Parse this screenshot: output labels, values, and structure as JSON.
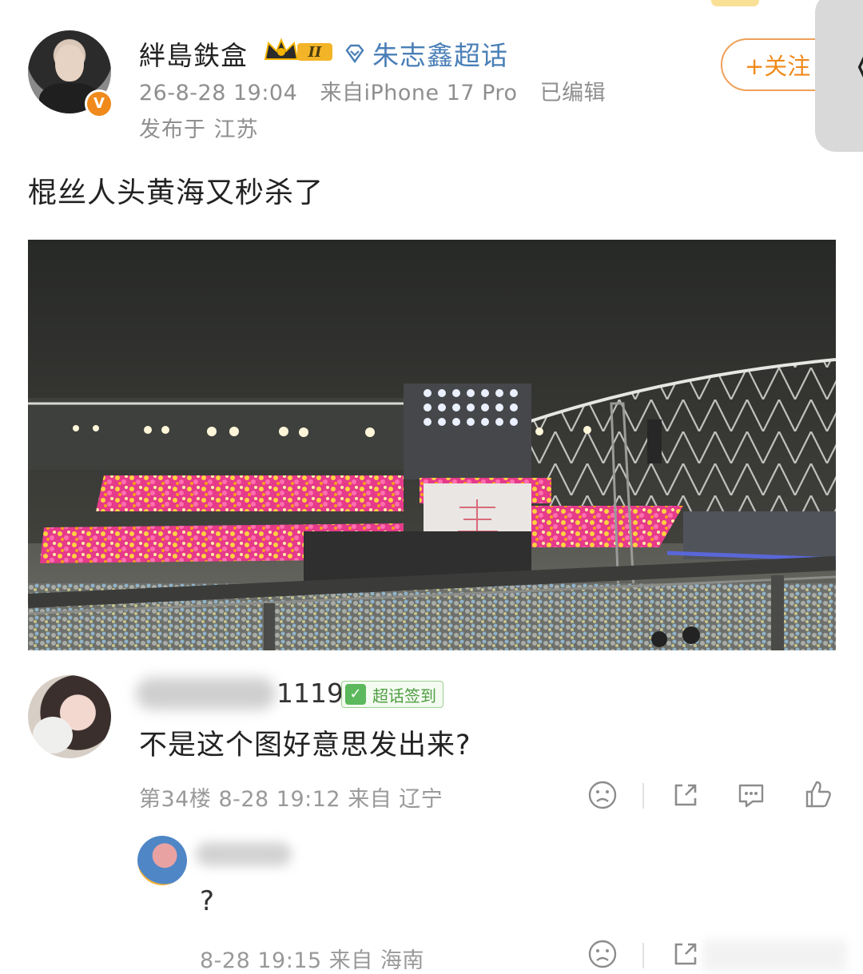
{
  "post": {
    "username": "絆島鉄盒",
    "level_badge": "II",
    "topic": "朱志鑫超话",
    "timestamp": "26-8-28 19:04",
    "source": "来自iPhone 17 Pro",
    "edited": "已编辑",
    "location": "发布于 江苏",
    "text": "棍丝人头黄海又秒杀了",
    "follow_label": "+关注",
    "back_glyph": "《"
  },
  "comments": [
    {
      "name_suffix": "1119",
      "checkin_label": "超话签到",
      "text": "不是这个图好意思发出来?",
      "meta": "第34楼 8-28 19:12 来自 辽宁"
    },
    {
      "text": "?",
      "meta": "8-28 19:15 来自 海南"
    }
  ],
  "icons": {
    "verified": "V",
    "dislike": "sad-face-icon",
    "share": "share-icon",
    "comment": "comment-icon",
    "like": "thumbs-up-icon"
  },
  "colors": {
    "accent_orange": "#f08a1c",
    "topic_blue": "#4a7fb7",
    "checkin_green": "#4f9e42"
  }
}
